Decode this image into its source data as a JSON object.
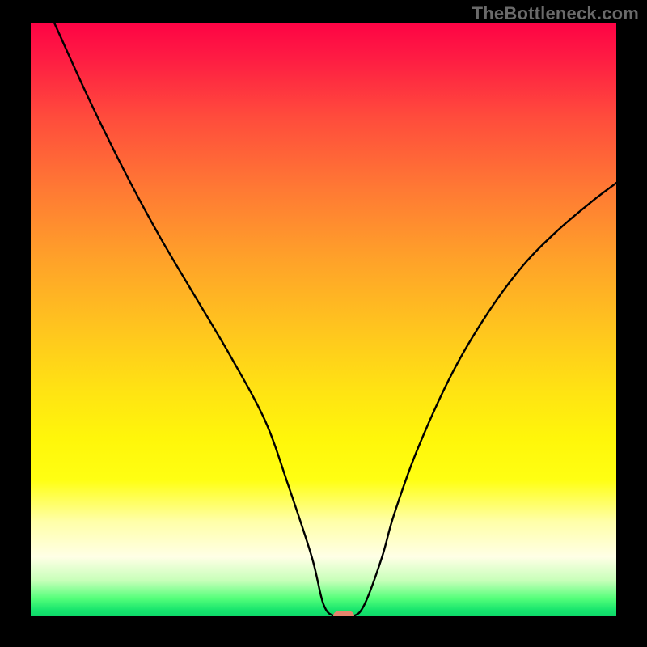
{
  "watermark": "TheBottleneck.com",
  "chart_data": {
    "type": "line",
    "title": "",
    "xlabel": "",
    "ylabel": "",
    "xlim": [
      0,
      100
    ],
    "ylim": [
      0,
      100
    ],
    "grid": false,
    "legend": false,
    "background_gradient": {
      "direction": "vertical",
      "stops": [
        {
          "pos": 0,
          "color": "#fe0345"
        },
        {
          "pos": 16,
          "color": "#ff4c3c"
        },
        {
          "pos": 40,
          "color": "#ffa229"
        },
        {
          "pos": 62,
          "color": "#ffe313"
        },
        {
          "pos": 84,
          "color": "#ffffa8"
        },
        {
          "pos": 97,
          "color": "#54ff7a"
        },
        {
          "pos": 100,
          "color": "#0ed869"
        }
      ]
    },
    "series": [
      {
        "name": "bottleneck-curve",
        "stroke": "#000000",
        "x": [
          4,
          10,
          16,
          22,
          28,
          34,
          40,
          44,
          48,
          50,
          52,
          55,
          57,
          60,
          62,
          66,
          72,
          78,
          84,
          90,
          96,
          100
        ],
        "values": [
          100,
          87,
          75,
          64,
          54,
          44,
          33,
          22,
          10,
          2,
          0,
          0,
          2,
          10,
          17,
          28,
          41,
          51,
          59,
          65,
          70,
          73
        ]
      }
    ],
    "marker": {
      "x": 53.5,
      "y": 0,
      "color": "#e5846d",
      "shape": "capsule"
    },
    "annotations": []
  }
}
